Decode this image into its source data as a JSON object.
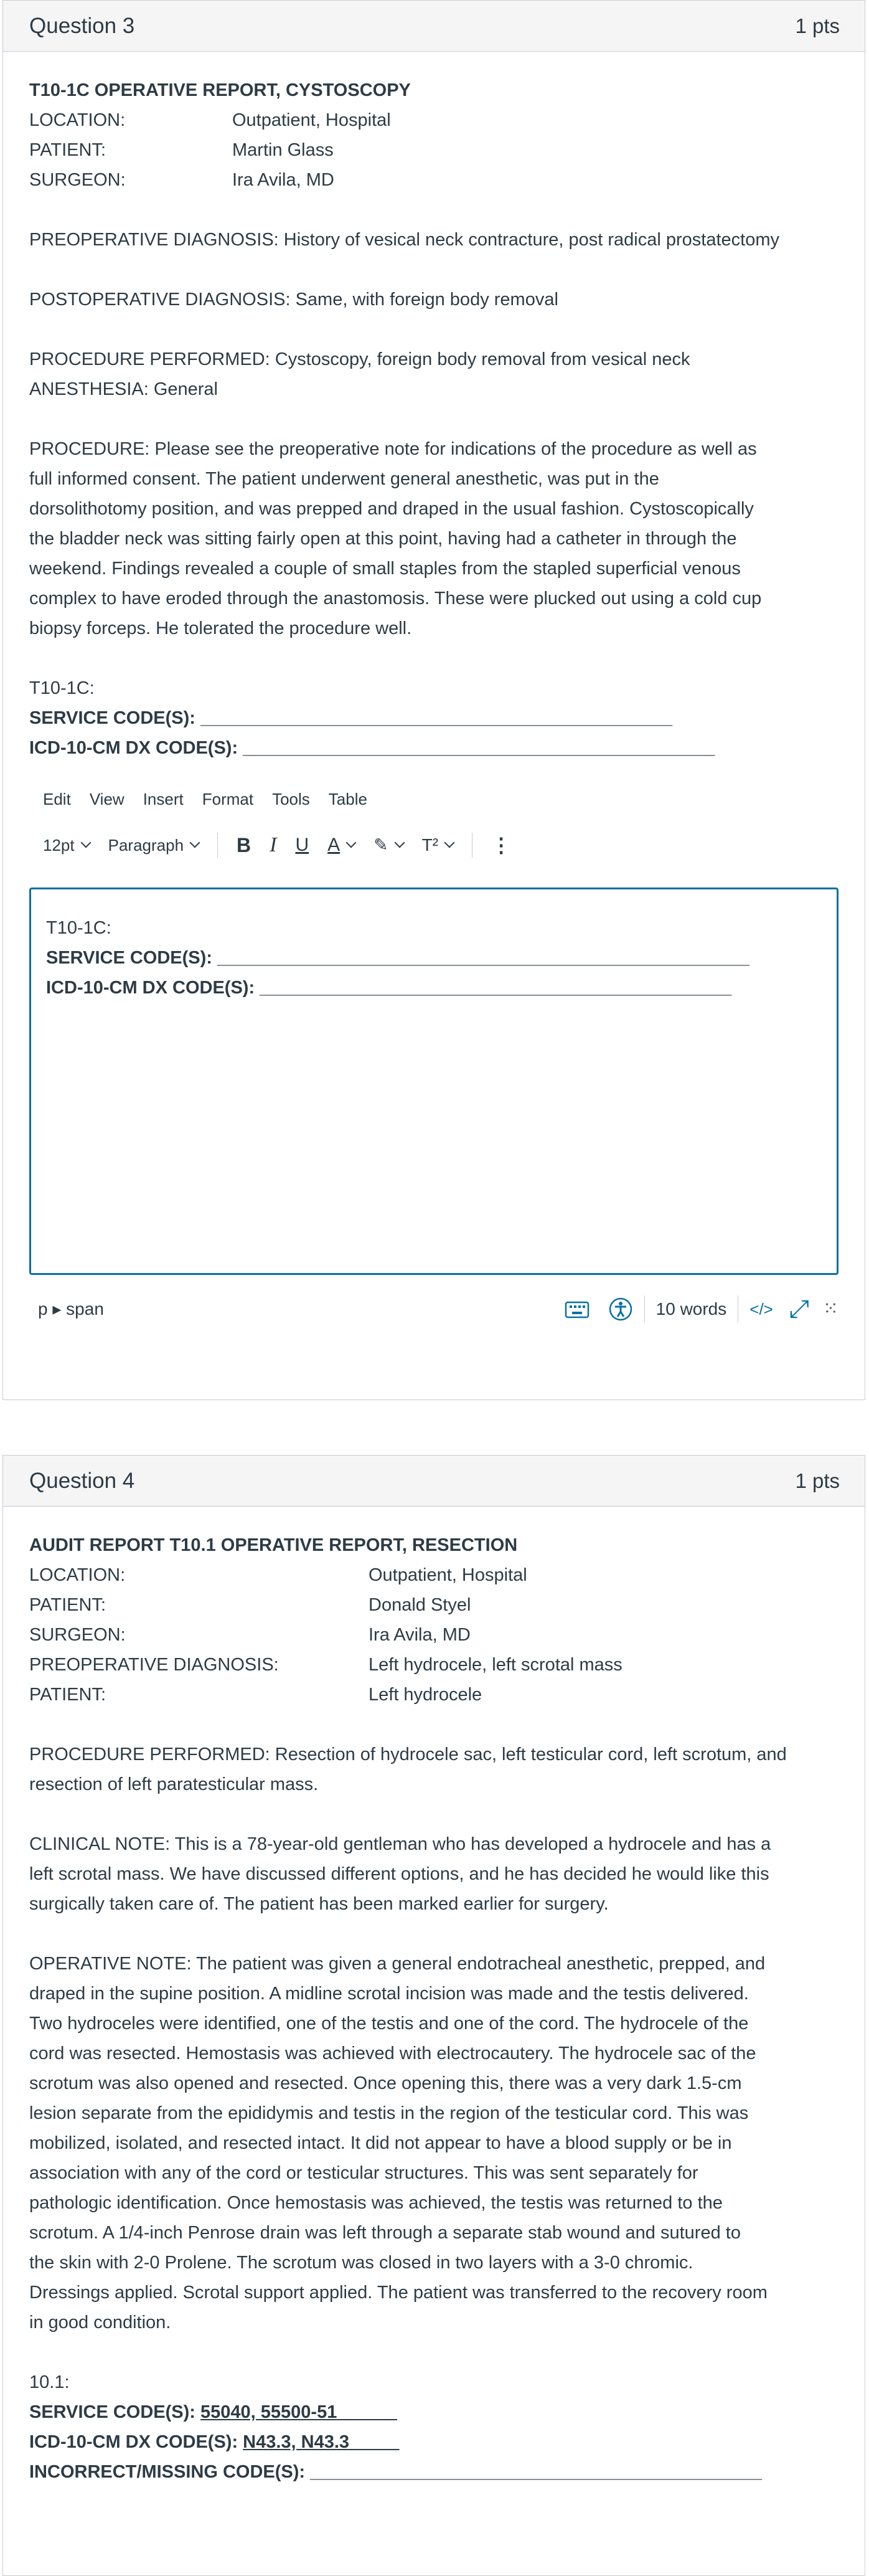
{
  "q3": {
    "title": "Question 3",
    "points": "1 pts",
    "report_title": "T10-1C OPERATIVE REPORT, CYSTOSCOPY",
    "fields": [
      {
        "label": "LOCATION:",
        "value": "Outpatient, Hospital"
      },
      {
        "label": "PATIENT:",
        "value": "Martin Glass"
      },
      {
        "label": "SURGEON:",
        "value": "Ira Avila, MD"
      }
    ],
    "preop": "PREOPERATIVE DIAGNOSIS: History of vesical neck contracture, post radical prostatectomy",
    "postop": "POSTOPERATIVE DIAGNOSIS: Same, with foreign body removal",
    "procedure_performed": "PROCEDURE PERFORMED: Cystoscopy, foreign body removal from vesical neck",
    "anesthesia": "ANESTHESIA: General",
    "procedure_lines": [
      "PROCEDURE: Please see the preoperative note for indications of the procedure as well as",
      "full informed consent. The patient underwent general anesthetic, was put in the",
      "dorsolithotomy position, and was prepped and draped in the usual fashion. Cystoscopically",
      "the bladder neck was sitting fairly open at this point, having had a catheter in through the",
      "weekend. Findings revealed a couple of small staples from the stapled superficial venous",
      "complex to have eroded through the anastomosis. These were plucked out using a cold cup",
      "biopsy forceps. He tolerated the procedure well."
    ],
    "code_heading": "T10-1C:",
    "service_label": "SERVICE CODE(S): ",
    "service_blank": "_______________________________________________",
    "icd_label": "ICD-10-CM DX CODE(S): ",
    "icd_blank": "_______________________________________________"
  },
  "editor": {
    "menu": [
      "Edit",
      "View",
      "Insert",
      "Format",
      "Tools",
      "Table"
    ],
    "font_size": "12pt",
    "block_format": "Paragraph",
    "bold": "B",
    "italic": "I",
    "underline": "U",
    "text_color": "A",
    "highlight": "✎",
    "superscript": "T²",
    "more": "⋮",
    "content_heading": "T10-1C:",
    "content_service_label": "SERVICE CODE(S): ",
    "content_service_blank": "_____________________________________________________",
    "content_icd_label": "ICD-10-CM DX CODE(S): ",
    "content_icd_blank": "_______________________________________________",
    "path": "p ▸ span",
    "word_count": "10 words",
    "html_toggle": "</>",
    "fullscreen": "⤢",
    "resize": "⁙",
    "accent_color": "#0770a3"
  },
  "q4": {
    "title": "Question 4",
    "points": "1 pts",
    "report_title": "AUDIT REPORT T10.1 OPERATIVE REPORT, RESECTION",
    "fields": [
      {
        "label": "LOCATION:",
        "value": "Outpatient, Hospital"
      },
      {
        "label": "PATIENT:",
        "value": "Donald Styel"
      },
      {
        "label": "SURGEON:",
        "value": "Ira Avila, MD"
      },
      {
        "label": "PREOPERATIVE DIAGNOSIS:",
        "value": "Left hydrocele, left scrotal mass"
      },
      {
        "label": "PATIENT:",
        "value": "Left hydrocele"
      }
    ],
    "procedure_lines": [
      "PROCEDURE PERFORMED: Resection of hydrocele sac, left testicular cord, left scrotum, and",
      "resection of left paratesticular mass."
    ],
    "clinical_lines": [
      "CLINICAL NOTE: This is a 78-year-old gentleman who has developed a hydrocele and has a",
      "left scrotal mass. We have discussed different options, and he has decided he would like this",
      "surgically taken care of. The patient has been marked earlier for surgery."
    ],
    "operative_lines": [
      "OPERATIVE NOTE: The patient was given a general endotracheal anesthetic, prepped, and",
      "draped in the supine position. A midline scrotal incision was made and the testis delivered.",
      "Two hydroceles were identified, one of the testis and one of the cord. The hydrocele of the",
      "cord was resected. Hemostasis was achieved with electrocautery. The hydrocele sac of the",
      "scrotum was also opened and resected. Once opening this, there was a very dark 1.5-cm",
      "lesion separate from the epididymis and testis in the region of the testicular cord. This was",
      "mobilized, isolated, and resected intact. It did not appear to have a blood supply or be in",
      "association with any of the cord or testicular structures. This was sent separately for",
      "pathologic identification. Once hemostasis was achieved, the testis was returned to the",
      "scrotum. A 1/4-inch Penrose drain was left through a separate stab wound and sutured to",
      "the skin with 2-0 Prolene. The scrotum was closed in two layers with a 3-0 chromic.",
      "Dressings applied. Scrotal support applied. The patient was transferred to the recovery room",
      "in good condition."
    ],
    "code_heading": "10.1:",
    "service_label": "SERVICE CODE(S): ",
    "service_value": "55040, 55500-51",
    "service_tail": "            ",
    "icd_label": "ICD-10-CM DX CODE(S): ",
    "icd_value": "N43.3, N43.3",
    "icd_tail": "          ",
    "incorrect_label": "INCORRECT/MISSING CODE(S): ",
    "incorrect_blank": "_____________________________________________"
  }
}
